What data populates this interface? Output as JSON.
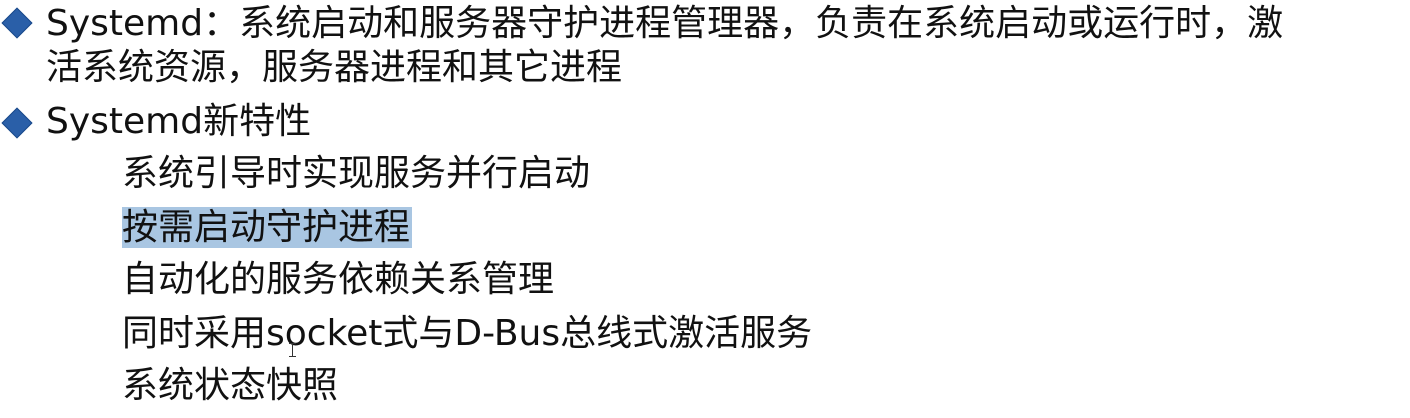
{
  "bullets": [
    {
      "icon": "diamond-bullet-icon",
      "line1": "Systemd：系统启动和服务器守护进程管理器，负责在系统启动或运行时，激",
      "line2": "活系统资源，服务器进程和其它进程"
    },
    {
      "icon": "diamond-bullet-icon",
      "text": "Systemd新特性"
    }
  ],
  "sub_items": [
    "系统引导时实现服务并行启动",
    "按需启动守护进程",
    "自动化的服务依赖关系管理",
    "同时采用socket式与D-Bus总线式激活服务",
    "系统状态快照"
  ],
  "colors": {
    "bullet": "#2a5fa8",
    "selection": "#a9c6e2",
    "text": "#111111"
  }
}
